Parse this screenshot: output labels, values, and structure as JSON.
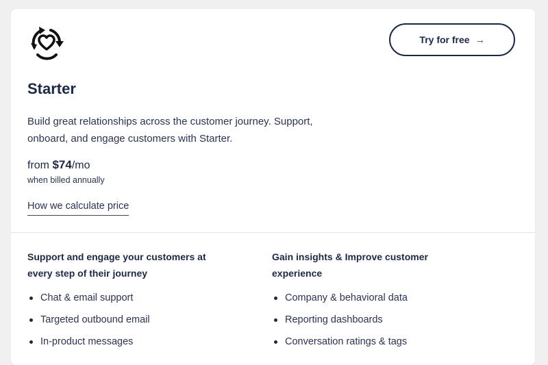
{
  "plan": {
    "logo_icon": "heart-cycle-icon",
    "title": "Starter",
    "description": "Build great relationships across the customer journey. Support, onboard, and engage customers with Starter.",
    "price_prefix": "from ",
    "price_amount": "$74",
    "price_suffix": "/mo",
    "billing_note": "when billed annually",
    "calc_link": "How we calculate price",
    "cta_label": "Try for free",
    "cta_arrow": "→"
  },
  "features": {
    "left": {
      "heading": "Support and engage your customers at every step of their journey",
      "items": [
        "Chat & email support",
        "Targeted outbound email",
        "In-product messages"
      ]
    },
    "right": {
      "heading": "Gain insights & Improve customer experience",
      "items": [
        "Company & behavioral data",
        "Reporting dashboards",
        "Conversation ratings & tags"
      ]
    }
  },
  "colors": {
    "page_bg": "#f0f0f0",
    "card_bg": "#ffffff",
    "text_dark": "#1b2944"
  }
}
